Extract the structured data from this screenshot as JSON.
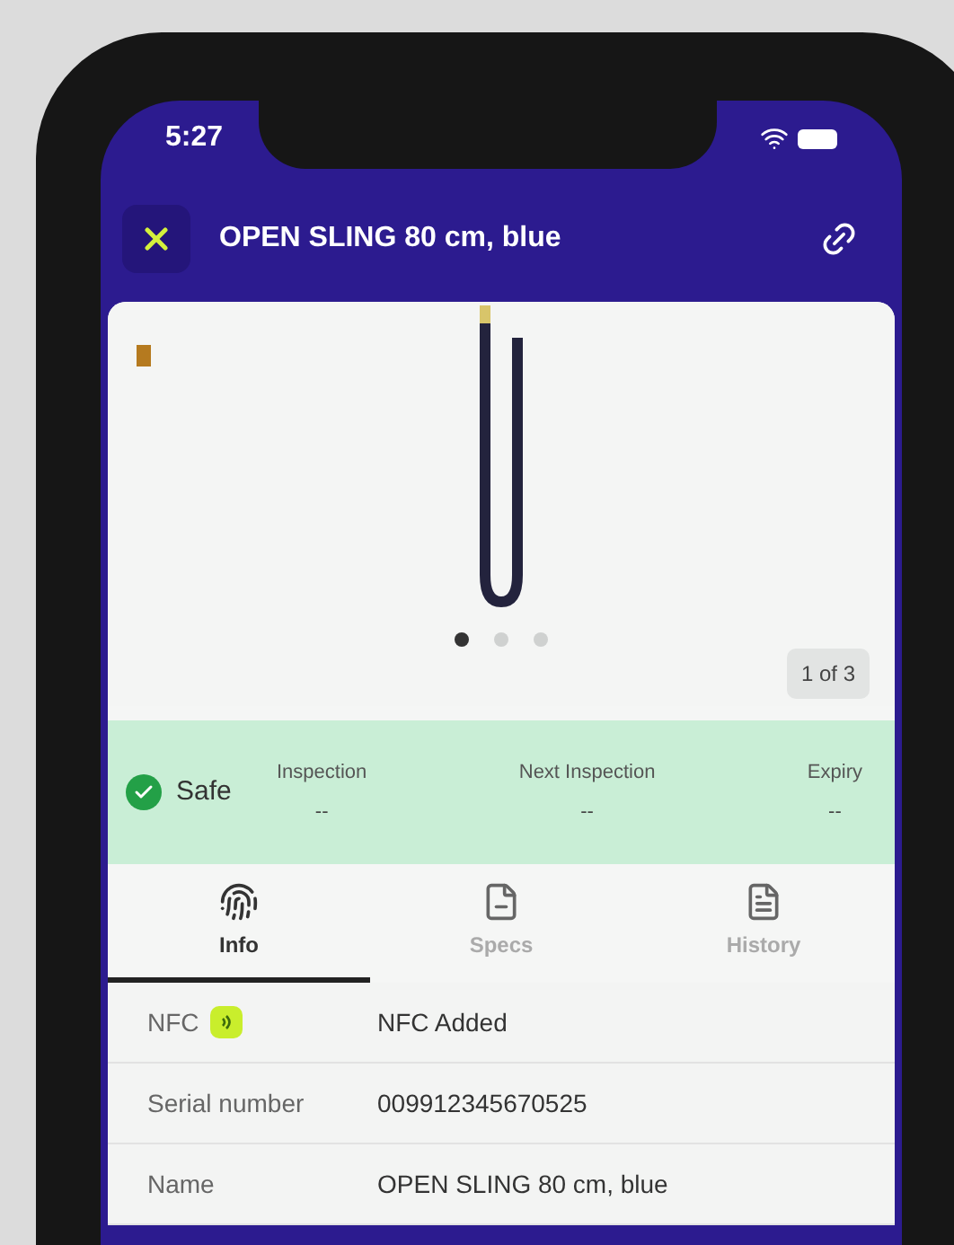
{
  "status_bar": {
    "time": "5:27"
  },
  "header": {
    "title": "OPEN SLING 80 cm, blue"
  },
  "gallery": {
    "dots": [
      {
        "selected": true
      },
      {
        "selected": false
      },
      {
        "selected": false
      }
    ],
    "counter": "1 of 3"
  },
  "status": {
    "label": "Safe",
    "fields": [
      {
        "label": "Inspection",
        "value": "--"
      },
      {
        "label": "Next Inspection",
        "value": "--"
      },
      {
        "label": "Expiry",
        "value": "--"
      }
    ]
  },
  "tabs": [
    {
      "label": "Info",
      "selected": true
    },
    {
      "label": "Specs",
      "selected": false
    },
    {
      "label": "History",
      "selected": false
    }
  ],
  "rows": [
    {
      "kind": "nfc",
      "label": "NFC",
      "value": "NFC Added"
    },
    {
      "kind": "text",
      "label": "Serial number",
      "value": "009912345670525"
    },
    {
      "kind": "text",
      "label": "Name",
      "value": "OPEN SLING 80 cm, blue"
    }
  ]
}
